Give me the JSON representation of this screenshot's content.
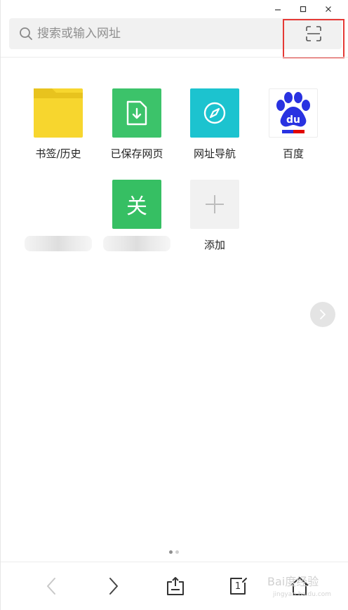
{
  "window_controls": {
    "minimize": "−",
    "maximize": "□",
    "close": "✕"
  },
  "search": {
    "placeholder": "搜索或输入网址",
    "icon": "search-icon",
    "scan_icon": "scan-icon"
  },
  "tiles": [
    {
      "label": "书签/历史",
      "icon": "folder-icon",
      "color": "#f7d62e"
    },
    {
      "label": "已保存网页",
      "icon": "download-file-icon",
      "color": "#3cc36a"
    },
    {
      "label": "网址导航",
      "icon": "compass-icon",
      "color": "#1cc3cf"
    },
    {
      "label": "百度",
      "icon": "baidu-paw-icon",
      "color": "#2932e1"
    },
    {
      "label": "",
      "icon": "blurred-site-icon",
      "color": "#d4323f"
    },
    {
      "label": "",
      "icon_text": "关",
      "icon": "guan-site-icon",
      "color": "#36bf63"
    },
    {
      "label": "添加",
      "icon": "plus-icon",
      "color": "#f1f1f1"
    }
  ],
  "pager": {
    "current": 1,
    "total": 2
  },
  "bottom_nav": {
    "back": "back-icon",
    "forward": "forward-icon",
    "share": "share-icon",
    "tabs": "tabs-icon",
    "tab_count": "1",
    "home": "home-icon"
  },
  "watermark": {
    "text": "Bai度经验",
    "sub": "jingyan.baidu.com"
  }
}
